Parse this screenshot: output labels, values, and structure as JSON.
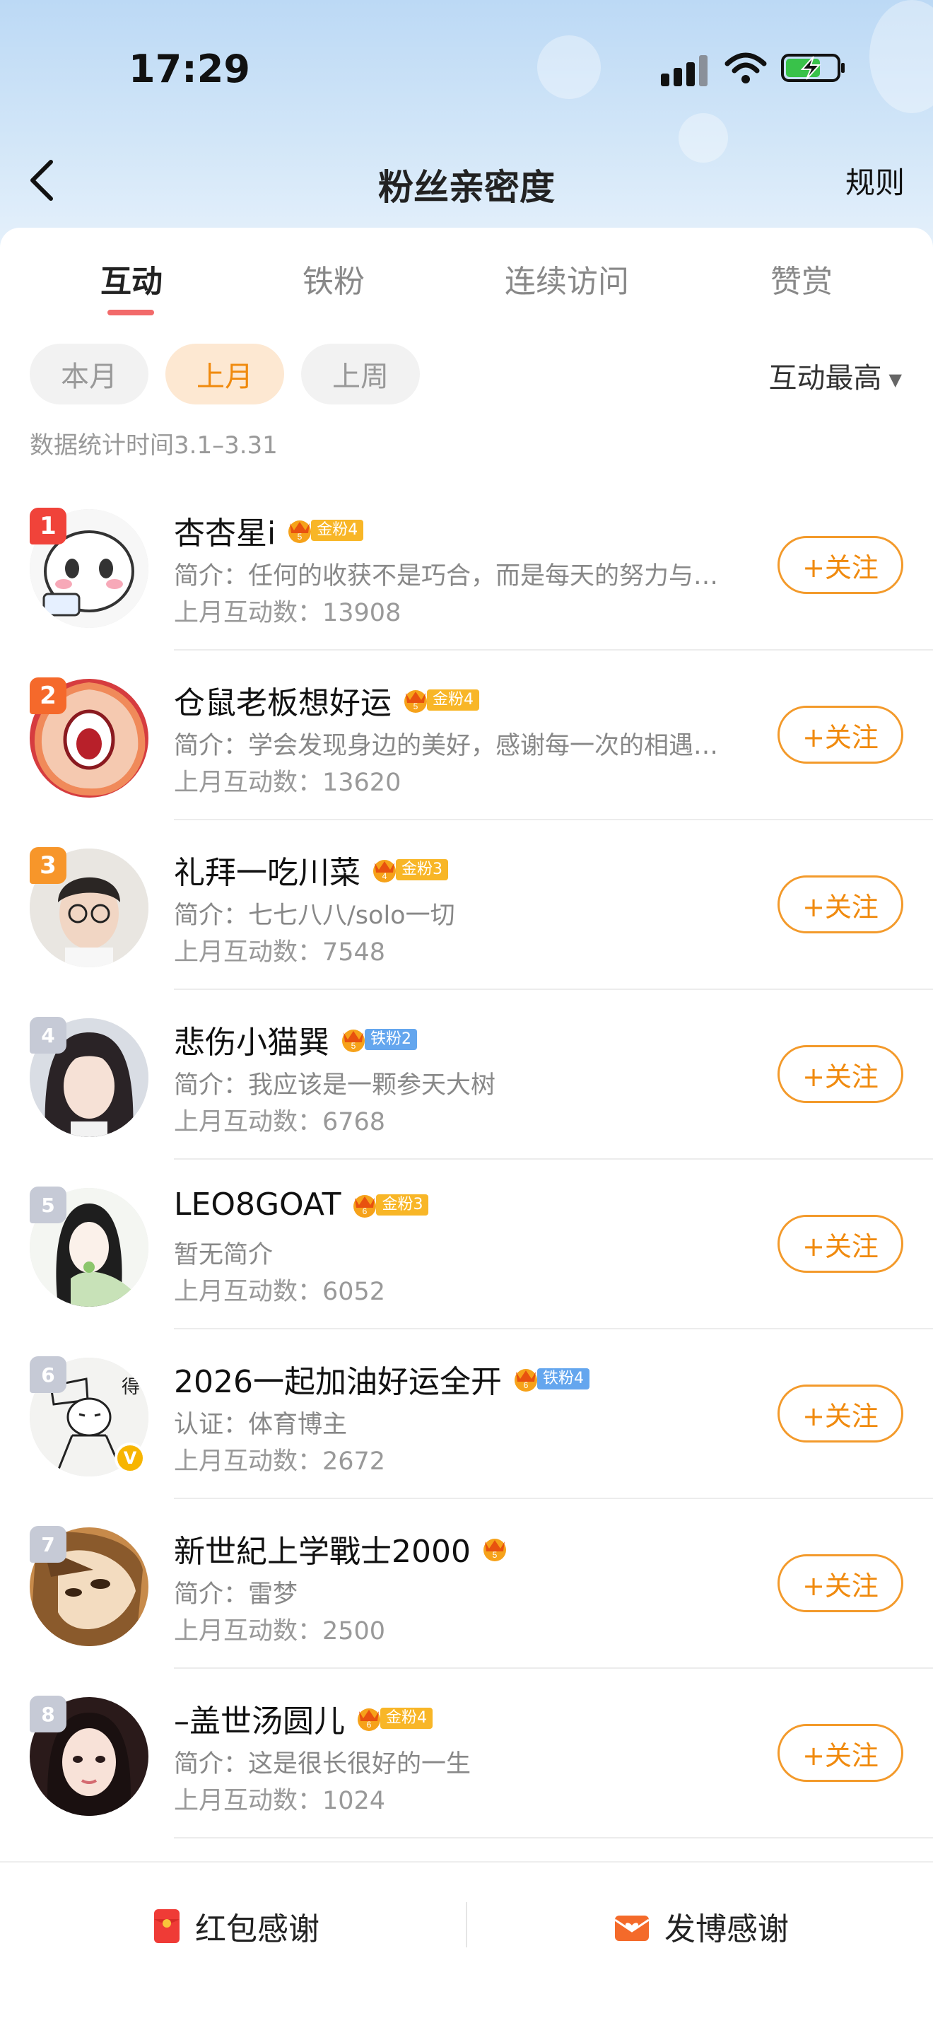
{
  "status_bar": {
    "time": "17:29"
  },
  "nav": {
    "title": "粉丝亲密度",
    "rule_label": "规则"
  },
  "tabs": [
    {
      "label": "互动",
      "active": true
    },
    {
      "label": "铁粉",
      "active": false
    },
    {
      "label": "连续访问",
      "active": false
    },
    {
      "label": "赞赏",
      "active": false
    }
  ],
  "filters": {
    "chips": [
      {
        "label": "本月",
        "active": false
      },
      {
        "label": "上月",
        "active": true
      },
      {
        "label": "上周",
        "active": false
      }
    ],
    "sort_label": "互动最高"
  },
  "stat_range": "数据统计时间3.1–3.31",
  "follow_label": "+关注",
  "fans": [
    {
      "rank": "1",
      "name": "杏杏星i",
      "badge_level": "5",
      "badge_type": "gold",
      "badge_label": "金粉4",
      "bio": "简介：任何的收获不是巧合，而是每天的努力与坚持",
      "count": "上月互动数：13908",
      "verified": false
    },
    {
      "rank": "2",
      "name": "仓鼠老板想好运",
      "badge_level": "5",
      "badge_type": "gold",
      "badge_label": "金粉4",
      "bio": "简介：学会发现身边的美好，感谢每一次的相遇与陪伴",
      "count": "上月互动数：13620",
      "verified": false
    },
    {
      "rank": "3",
      "name": "礼拜一吃川菜",
      "badge_level": "4",
      "badge_type": "gold",
      "badge_label": "金粉3",
      "bio": "简介：七七八八/solo一切",
      "count": "上月互动数：7548",
      "verified": false
    },
    {
      "rank": "4",
      "name": "悲伤小猫巽",
      "badge_level": "5",
      "badge_type": "iron",
      "badge_label": "铁粉2",
      "bio": "简介：我应该是一颗参天大树",
      "count": "上月互动数：6768",
      "verified": false
    },
    {
      "rank": "5",
      "name": "LEO8GOAT",
      "badge_level": "6",
      "badge_type": "gold",
      "badge_label": "金粉3",
      "bio": "暂无简介",
      "count": "上月互动数：6052",
      "verified": false
    },
    {
      "rank": "6",
      "name": "2026一起加油好运全开",
      "badge_level": "6",
      "badge_type": "iron",
      "badge_label": "铁粉4",
      "bio": "认证：体育博主",
      "count": "上月互动数：2672",
      "verified": true
    },
    {
      "rank": "7",
      "name": "新世紀上学戰士2000",
      "badge_level": "5",
      "badge_type": "none",
      "badge_label": "",
      "bio": "简介：雷梦",
      "count": "上月互动数：2500",
      "verified": false
    },
    {
      "rank": "8",
      "name": "–盖世汤圆儿",
      "badge_level": "6",
      "badge_type": "gold",
      "badge_label": "金粉4",
      "bio": "简介：这是很长很好的一生",
      "count": "上月互动数：1024",
      "verified": false
    }
  ],
  "bottom_bar": {
    "red_packet_label": "红包感谢",
    "post_label": "发博感谢"
  },
  "colors": {
    "accent": "#f08a0e",
    "tab_indicator": "#f26a6a",
    "gold_badge": "#f8b627",
    "iron_badge": "#64a6ee"
  }
}
